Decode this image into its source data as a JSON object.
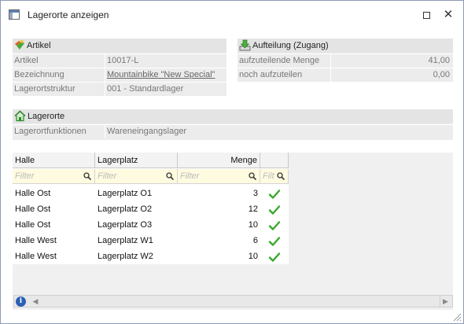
{
  "window": {
    "title": "Lagerorte anzeigen"
  },
  "artikel": {
    "header": "Artikel",
    "rows": [
      {
        "label": "Artikel",
        "value": "10017-L"
      },
      {
        "label": "Bezeichnung",
        "value": "Mountainbike \"New Special\""
      },
      {
        "label": "Lagerortstruktur",
        "value": "001 - Standardlager"
      }
    ]
  },
  "aufteilung": {
    "header": "Aufteilung (Zugang)",
    "rows": [
      {
        "label": "aufzuteilende Menge",
        "value": "41,00"
      },
      {
        "label": "noch aufzuteilen",
        "value": "0,00"
      }
    ]
  },
  "lagerorte": {
    "header": "Lagerorte",
    "rows": [
      {
        "label": "Lagerortfunktionen",
        "value": "Wareneingangslager"
      }
    ]
  },
  "grid": {
    "columns": [
      "Halle",
      "Lagerplatz",
      "Menge",
      ""
    ],
    "filter_placeholders": [
      "Filter",
      "Filter",
      "Filter",
      "Filt"
    ],
    "rows": [
      {
        "halle": "Halle Ost",
        "lagerplatz": "Lagerplatz O1",
        "menge": "3"
      },
      {
        "halle": "Halle Ost",
        "lagerplatz": "Lagerplatz O2",
        "menge": "12"
      },
      {
        "halle": "Halle Ost",
        "lagerplatz": "Lagerplatz O3",
        "menge": "10"
      },
      {
        "halle": "Halle West",
        "lagerplatz": "Lagerplatz W1",
        "menge": "6"
      },
      {
        "halle": "Halle West",
        "lagerplatz": "Lagerplatz W2",
        "menge": "10"
      }
    ]
  },
  "icons": {
    "window": "window-icon",
    "artikel": "artikel-icon",
    "aufteilung": "download-tray-icon",
    "lagerorte": "house-icon",
    "filter": "magnifier-icon",
    "check": "checkmark-icon",
    "info": "info-icon"
  },
  "colors": {
    "check": "#3aa82e",
    "info": "#2b5fb3",
    "filter_bg": "#fffbe0"
  }
}
